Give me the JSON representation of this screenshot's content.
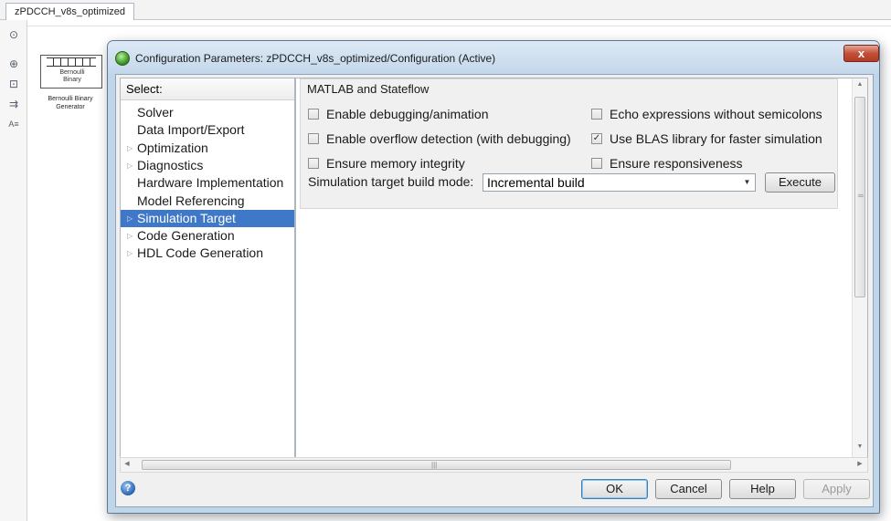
{
  "model": {
    "tab_label": "zPDCCH_v8s_optimized",
    "block": {
      "line1": "Bernoulli",
      "line2": "Binary",
      "caption_line1": "Bernoulli Binary",
      "caption_line2": "Generator"
    }
  },
  "dialog": {
    "title": "Configuration Parameters: zPDCCH_v8s_optimized/Configuration (Active)",
    "close_symbol": "x",
    "tree": {
      "header": "Select:",
      "items": [
        {
          "label": "Solver",
          "expandable": false,
          "selected": false
        },
        {
          "label": "Data Import/Export",
          "expandable": false,
          "selected": false
        },
        {
          "label": "Optimization",
          "expandable": true,
          "selected": false
        },
        {
          "label": "Diagnostics",
          "expandable": true,
          "selected": false
        },
        {
          "label": "Hardware Implementation",
          "expandable": false,
          "selected": false
        },
        {
          "label": "Model Referencing",
          "expandable": false,
          "selected": false
        },
        {
          "label": "Simulation Target",
          "expandable": true,
          "selected": true
        },
        {
          "label": "Code Generation",
          "expandable": true,
          "selected": false
        },
        {
          "label": "HDL Code Generation",
          "expandable": true,
          "selected": false
        }
      ]
    },
    "content": {
      "group_title": "MATLAB and Stateflow",
      "options": [
        {
          "label": "Enable debugging/animation",
          "checked": false
        },
        {
          "label": "Echo expressions without semicolons",
          "checked": false
        },
        {
          "label": "Enable overflow detection (with debugging)",
          "checked": false
        },
        {
          "label": "Use BLAS library for faster simulation",
          "checked": true
        },
        {
          "label": "Ensure memory integrity",
          "checked": false
        },
        {
          "label": "Ensure responsiveness",
          "checked": false
        }
      ],
      "build_mode_label": "Simulation target build mode:",
      "build_mode_value": "Incremental build",
      "execute_label": "Execute"
    },
    "buttons": {
      "ok": "OK",
      "cancel": "Cancel",
      "help": "Help",
      "apply": "Apply"
    }
  },
  "colors": {
    "selection": "#3f78c7",
    "window_frame": "#bfd5ea",
    "close_button": "#c2513a"
  }
}
